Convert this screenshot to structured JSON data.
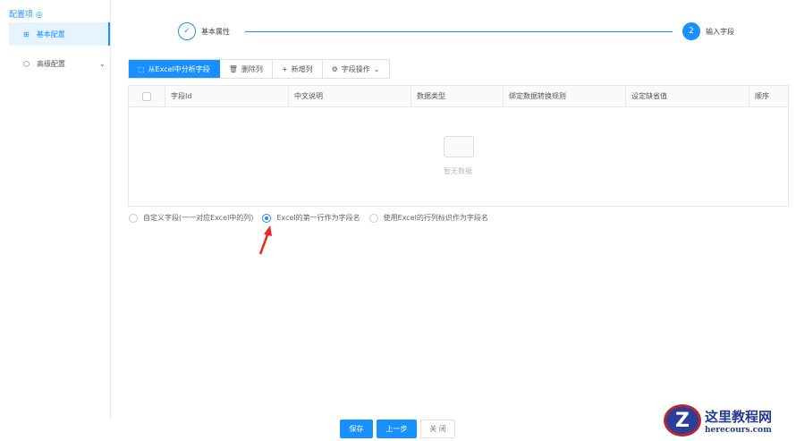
{
  "sidebar": {
    "title": "配置项",
    "items": [
      {
        "label": "基本配置"
      },
      {
        "label": "高级配置"
      }
    ]
  },
  "steps": [
    {
      "label": "基本属性",
      "status": "done"
    },
    {
      "number": "2",
      "label": "输入字段",
      "status": "active"
    }
  ],
  "toolbar": {
    "analyze": "从Excel中分析字段",
    "delete_col": "删除列",
    "add_col": "新增列",
    "field_ops": "字段操作"
  },
  "table": {
    "columns": [
      "字段Id",
      "中文说明",
      "数据类型",
      "绑定数据转换规则",
      "设定缺省值",
      "顺序"
    ],
    "empty_text": "暂无数据"
  },
  "radios": [
    {
      "label": "自定义字段(一一对应Excel中的列)",
      "checked": false
    },
    {
      "label": "Excel的第一行作为字段名",
      "checked": true
    },
    {
      "label": "使用Excel的行列标识作为字段名",
      "checked": false
    }
  ],
  "footer": {
    "save": "保存",
    "prev": "上一步",
    "close": "关 闭"
  },
  "watermark": {
    "title": "这里教程网",
    "url": "herecours.com"
  },
  "colors": {
    "primary": "#1890ff"
  }
}
